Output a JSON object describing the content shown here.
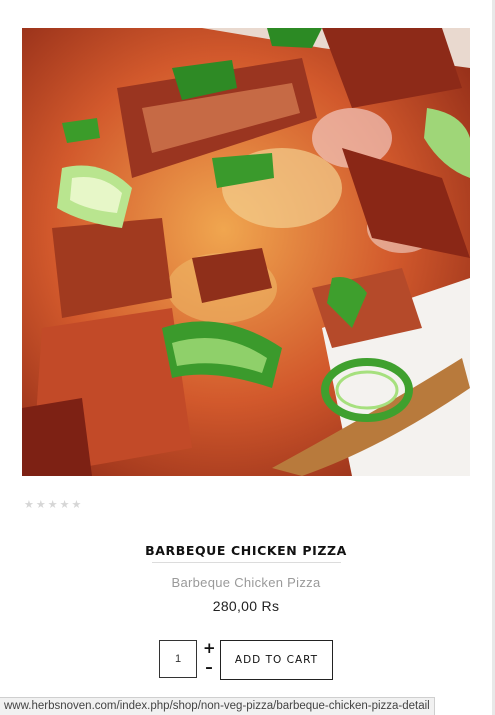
{
  "product": {
    "image_alt": "Barbeque Chicken Pizza",
    "rating": {
      "value": 0,
      "max": 5
    },
    "title": "BARBEQUE CHICKEN PIZZA",
    "subtitle": "Barbeque Chicken Pizza",
    "price": "280,00 Rs"
  },
  "cart": {
    "quantity": "1",
    "plus_label": "+",
    "minus_label": "–",
    "add_label": "ADD TO CART"
  },
  "status_bar": {
    "url": "www.herbsnoven.com/index.php/shop/non-veg-pizza/barbeque-chicken-pizza-detail"
  },
  "icons": {
    "star": "star-icon",
    "plus": "plus-icon",
    "minus": "minus-icon"
  }
}
